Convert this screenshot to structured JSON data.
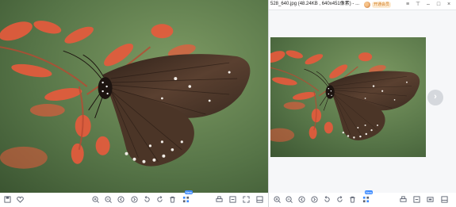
{
  "window_title": "528_640.jpg (48.24KB , 640x451像素) - ...",
  "vip_label": "开通会员",
  "badge_label": "New",
  "next_arrow": "›",
  "icons": {
    "left_toolbar": [
      "save-icon",
      "favorite-icon",
      "zoom-in-icon",
      "zoom-out-icon",
      "prev-icon",
      "next-icon",
      "rotate-left-icon",
      "rotate-right-icon",
      "delete-icon",
      "ai-tools-icon",
      "print-icon",
      "fit-icon",
      "fullscreen-icon",
      "more-icon"
    ],
    "right_toolbar": [
      "zoom-in-icon",
      "zoom-out-icon",
      "prev-icon",
      "next-icon",
      "rotate-left-icon",
      "rotate-right-icon",
      "delete-icon",
      "ai-tools-icon",
      "print-icon",
      "fit-icon",
      "slideshow-icon",
      "more-icon"
    ]
  },
  "colors": {
    "accent": "#3d8bff",
    "butterfly": "#4a3426",
    "flower": "#e85a3c",
    "background": "#5c7c4a"
  }
}
